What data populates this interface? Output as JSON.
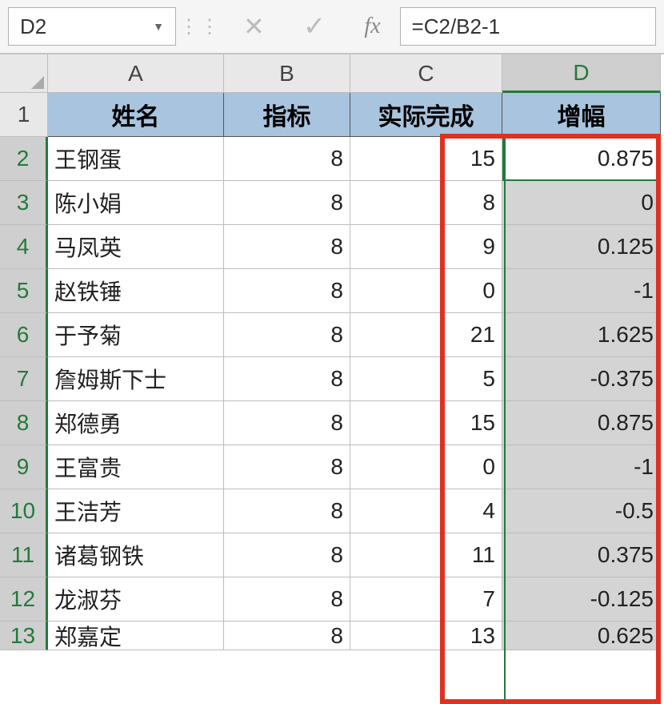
{
  "namebox": "D2",
  "formula": "=C2/B2-1",
  "columns": [
    "A",
    "B",
    "C",
    "D"
  ],
  "headers": {
    "A": "姓名",
    "B": "指标",
    "C": "实际完成",
    "D": "增幅"
  },
  "rows": [
    {
      "n": "2",
      "A": "王钢蛋",
      "B": "8",
      "C": "15",
      "D": "0.875"
    },
    {
      "n": "3",
      "A": "陈小娟",
      "B": "8",
      "C": "8",
      "D": "0"
    },
    {
      "n": "4",
      "A": "马凤英",
      "B": "8",
      "C": "9",
      "D": "0.125"
    },
    {
      "n": "5",
      "A": "赵铁锤",
      "B": "8",
      "C": "0",
      "D": "-1"
    },
    {
      "n": "6",
      "A": "于予菊",
      "B": "8",
      "C": "21",
      "D": "1.625"
    },
    {
      "n": "7",
      "A": "詹姆斯下士",
      "B": "8",
      "C": "5",
      "D": "-0.375"
    },
    {
      "n": "8",
      "A": "郑德勇",
      "B": "8",
      "C": "15",
      "D": "0.875"
    },
    {
      "n": "9",
      "A": "王富贵",
      "B": "8",
      "C": "0",
      "D": "-1"
    },
    {
      "n": "10",
      "A": "王洁芳",
      "B": "8",
      "C": "4",
      "D": "-0.5"
    },
    {
      "n": "11",
      "A": "诸葛钢铁",
      "B": "8",
      "C": "11",
      "D": "0.375"
    },
    {
      "n": "12",
      "A": "龙淑芬",
      "B": "8",
      "C": "7",
      "D": "-0.125"
    },
    {
      "n": "13",
      "A": "郑嘉定",
      "B": "8",
      "C": "13",
      "D": "0.625"
    }
  ]
}
